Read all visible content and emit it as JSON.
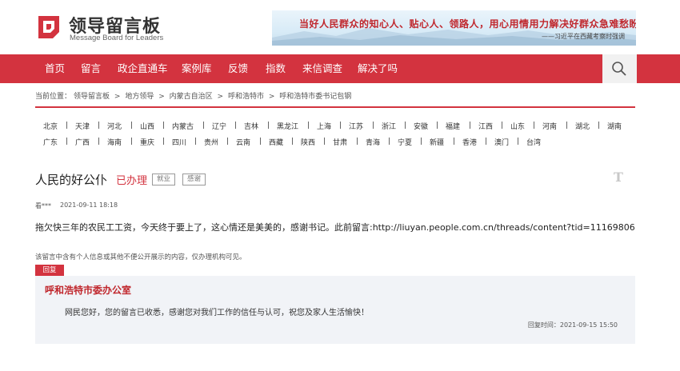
{
  "header": {
    "logo_title": "领导留言板",
    "logo_subtitle": "Message Board for Leaders",
    "banner_line1": "当好人民群众的知心人、贴心人、领路人，用心用情用力解决好群众急难愁盼问题。",
    "banner_line2": "——习近平在西藏考察时强调"
  },
  "nav": {
    "items": [
      "首页",
      "留言",
      "政企直通车",
      "案例库",
      "反馈",
      "指数",
      "来信调查",
      "解决了吗"
    ]
  },
  "breadcrumb": {
    "prefix": "当前位置：",
    "items": [
      "领导留言板",
      ">",
      "地方领导",
      ">",
      "内蒙古自治区",
      ">",
      "呼和浩特市",
      ">",
      "呼和浩特市委书记包钢"
    ]
  },
  "regions": {
    "row1": [
      "北京",
      "天津",
      "河北",
      "山西",
      "内蒙古",
      "辽宁",
      "吉林",
      "黑龙江",
      "上海",
      "江苏",
      "浙江",
      "安徽",
      "福建",
      "江西",
      "山东",
      "河南",
      "湖北",
      "湖南"
    ],
    "row2": [
      "广东",
      "广西",
      "海南",
      "重庆",
      "四川",
      "贵州",
      "云南",
      "西藏",
      "陕西",
      "甘肃",
      "青海",
      "宁夏",
      "新疆",
      "香港",
      "澳门",
      "台湾"
    ]
  },
  "message": {
    "title": "人民的好公仆",
    "status": "已办理",
    "tags": [
      "就业",
      "感谢"
    ],
    "font_icon": "T",
    "author": "看***",
    "date": "2021-09-11 18:18",
    "content": "拖欠快三年的农民工工资，今天终于要上了，这心情还是美美的，感谢书记。此前留言:http://liuyan.people.com.cn/threads/content?tid=11169806",
    "notice": "该留言中含有个人信息或其他不便公开展示的内容，仅办理机构可见。"
  },
  "reply": {
    "label": "回复",
    "org": "呼和浩特市委办公室",
    "text": "网民您好，您的留言已收悉，感谢您对我们工作的信任与认可，祝您及家人生活愉快！",
    "time": "回复时间：2021-09-15 15:50"
  },
  "colors": {
    "brand_red": "#d3333f",
    "reply_bg": "#f1f3f7"
  },
  "icons": {
    "search": "search-icon",
    "logo": "logo-mark-icon",
    "font_size": "font-size-icon"
  }
}
